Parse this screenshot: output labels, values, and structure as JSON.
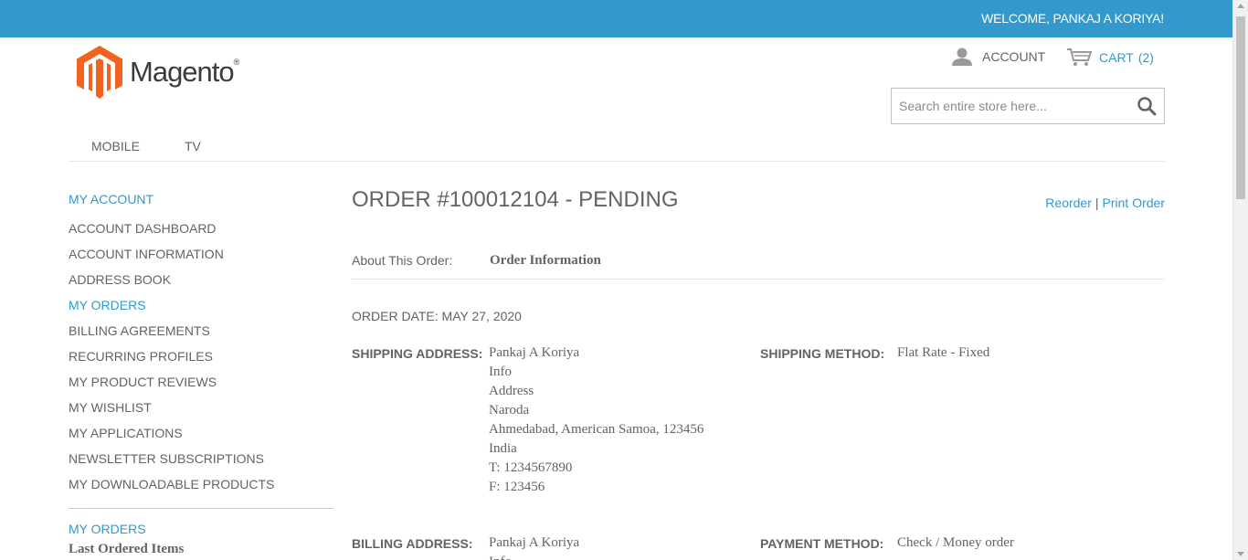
{
  "header": {
    "welcome": "WELCOME, PANKAJ A KORIYA!",
    "logo_text": "Magento",
    "logo_reg": "®",
    "account_label": "ACCOUNT",
    "cart_label": "CART",
    "cart_count": "(2)",
    "search_placeholder": "Search entire store here..."
  },
  "nav": {
    "items": [
      {
        "label": "MOBILE"
      },
      {
        "label": "TV"
      }
    ]
  },
  "sidebar": {
    "title": "MY ACCOUNT",
    "items": [
      {
        "label": "ACCOUNT DASHBOARD"
      },
      {
        "label": "ACCOUNT INFORMATION"
      },
      {
        "label": "ADDRESS BOOK"
      },
      {
        "label": "MY ORDERS"
      },
      {
        "label": "BILLING AGREEMENTS"
      },
      {
        "label": "RECURRING PROFILES"
      },
      {
        "label": "MY PRODUCT REVIEWS"
      },
      {
        "label": "MY WISHLIST"
      },
      {
        "label": "MY APPLICATIONS"
      },
      {
        "label": "NEWSLETTER SUBSCRIPTIONS"
      },
      {
        "label": "MY DOWNLOADABLE PRODUCTS"
      }
    ],
    "active_item": "MY ORDERS",
    "section2_title": "MY ORDERS",
    "last_ordered": "Last Ordered Items"
  },
  "order": {
    "title": "ORDER #100012104 - PENDING",
    "reorder_label": "Reorder",
    "separator": "|",
    "print_label": "Print Order",
    "about_label": "About This Order:",
    "about_tab": "Order Information",
    "order_date": "ORDER DATE: MAY 27, 2020",
    "shipping_address_label": "SHIPPING ADDRESS:",
    "shipping_address": [
      "Pankaj A Koriya",
      "Info",
      "Address",
      "Naroda",
      "Ahmedabad, American Samoa, 123456",
      "India",
      "T: 1234567890",
      "F: 123456"
    ],
    "shipping_method_label": "SHIPPING METHOD:",
    "shipping_method": "Flat Rate - Fixed",
    "billing_address_label": "BILLING ADDRESS:",
    "billing_address": [
      "Pankaj A Koriya",
      "Info"
    ],
    "payment_method_label": "PAYMENT METHOD:",
    "payment_method": "Check / Money order"
  },
  "colors": {
    "accent": "#3399cc",
    "text": "#636363",
    "logo_orange": "#f26322"
  }
}
